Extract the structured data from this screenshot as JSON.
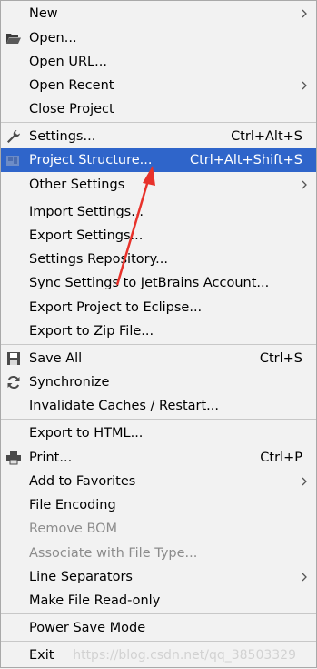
{
  "menu": {
    "new": "New",
    "open": "Open...",
    "open_url": "Open URL...",
    "open_recent": "Open Recent",
    "close_project": "Close Project",
    "settings": "Settings...",
    "settings_shortcut": "Ctrl+Alt+S",
    "project_structure": "Project Structure...",
    "project_structure_shortcut": "Ctrl+Alt+Shift+S",
    "other_settings": "Other Settings",
    "import_settings": "Import Settings...",
    "export_settings": "Export Settings...",
    "settings_repository": "Settings Repository...",
    "sync_settings": "Sync Settings to JetBrains Account...",
    "export_eclipse": "Export Project to Eclipse...",
    "export_zip": "Export to Zip File...",
    "save_all": "Save All",
    "save_all_shortcut": "Ctrl+S",
    "synchronize": "Synchronize",
    "invalidate": "Invalidate Caches / Restart...",
    "export_html": "Export to HTML...",
    "print": "Print...",
    "print_shortcut": "Ctrl+P",
    "add_favorites": "Add to Favorites",
    "file_encoding": "File Encoding",
    "remove_bom": "Remove BOM",
    "associate_file_type": "Associate with File Type...",
    "line_separators": "Line Separators",
    "make_read_only": "Make File Read-only",
    "power_save": "Power Save Mode",
    "exit": "Exit"
  },
  "watermark": "https://blog.csdn.net/qq_38503329",
  "colors": {
    "selected_bg": "#2f65ca",
    "annotation_arrow": "#e8322b"
  }
}
